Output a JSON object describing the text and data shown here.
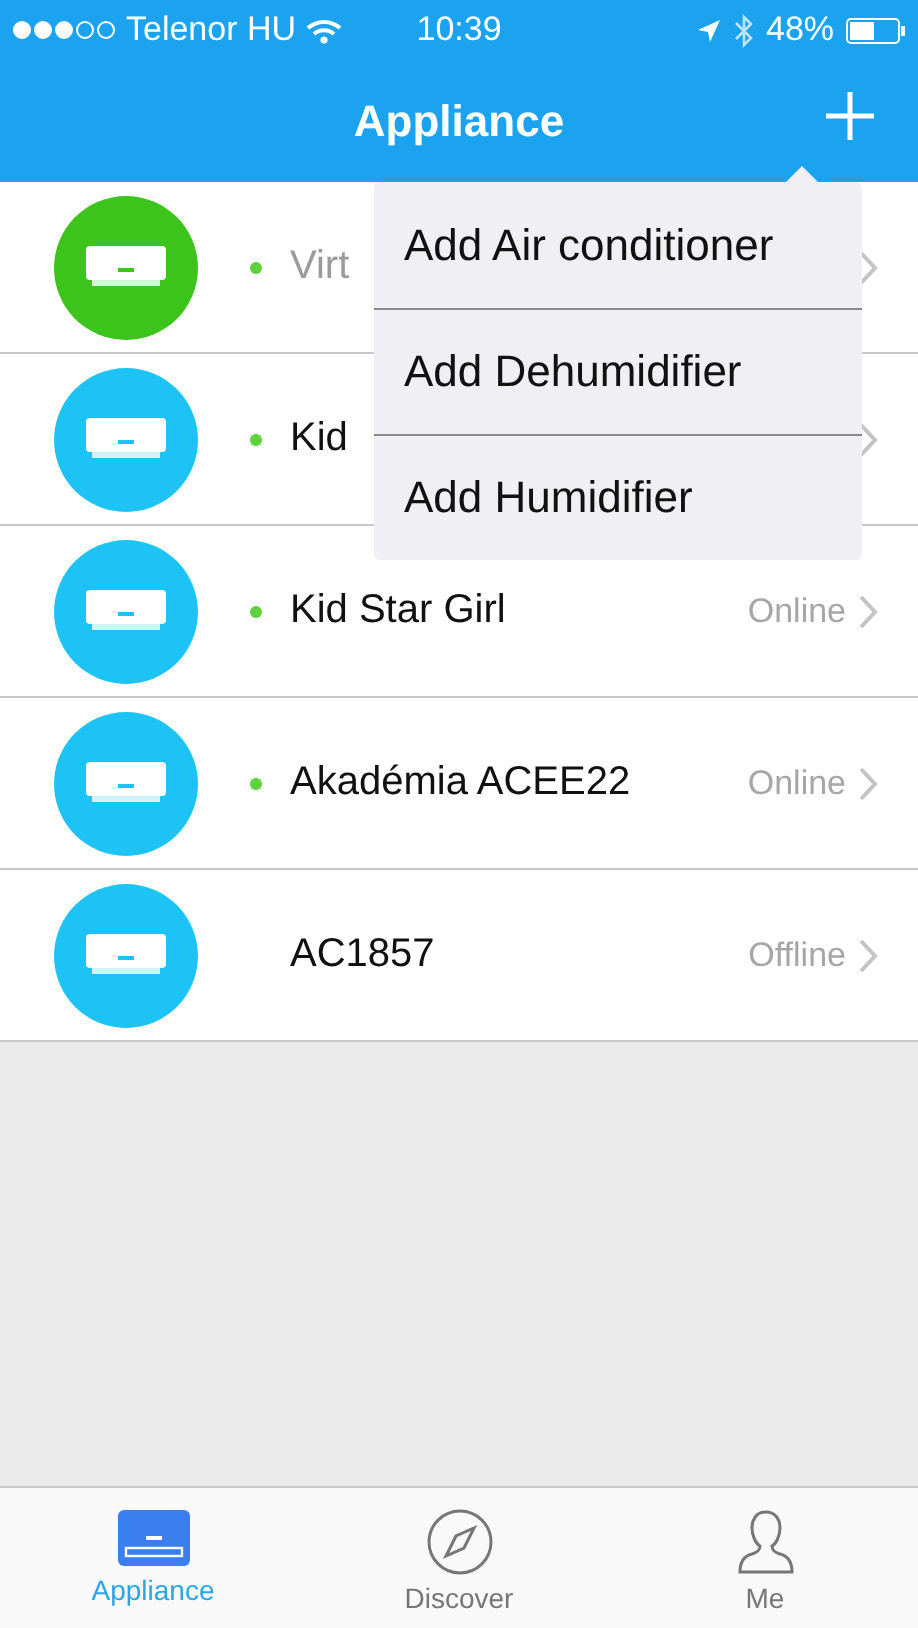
{
  "status_bar": {
    "carrier": "Telenor HU",
    "time": "10:39",
    "battery": "48%"
  },
  "header": {
    "title": "Appliance"
  },
  "appliances": [
    {
      "name": "Virt",
      "color": "#3cc41c",
      "connected": true,
      "dimmed": true
    },
    {
      "name": "Kid",
      "color": "#1ec3f5",
      "connected": true,
      "dimmed": false
    },
    {
      "name": "Kid Star Girl",
      "color": "#1ec3f5",
      "connected": true,
      "dimmed": false,
      "status": "Online"
    },
    {
      "name": "Akadémia ACEE22",
      "color": "#1ec3f5",
      "connected": true,
      "dimmed": false,
      "status": "Online"
    },
    {
      "name": "AC1857",
      "color": "#1ec3f5",
      "connected": false,
      "dimmed": false,
      "status": "Offline"
    }
  ],
  "add_menu": {
    "items": [
      "Add Air conditioner",
      "Add Dehumidifier",
      "Add Humidifier"
    ]
  },
  "tab_bar": [
    {
      "label": "Appliance",
      "kind": "appliance",
      "selected": true
    },
    {
      "label": "Discover",
      "kind": "compass",
      "selected": false
    },
    {
      "label": "Me",
      "kind": "person",
      "selected": false
    }
  ]
}
